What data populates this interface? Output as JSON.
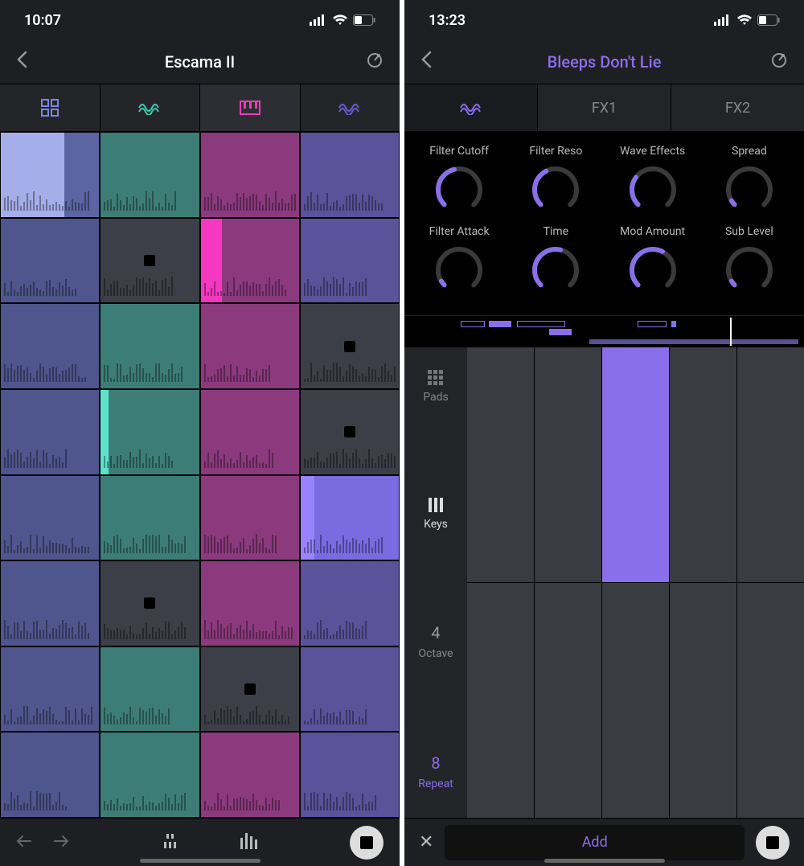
{
  "left": {
    "status_time": "10:07",
    "title": "Escama II",
    "tabs": [
      {
        "icon": "grid",
        "color": "#7a86e8"
      },
      {
        "icon": "wave",
        "color": "#3ec9b0"
      },
      {
        "icon": "keyboard",
        "color": "#e83fb5"
      },
      {
        "icon": "wave",
        "color": "#6a5acd"
      }
    ],
    "clips": [
      [
        {
          "c": "#5c64a3",
          "fill": 0.65,
          "fillc": "#aeb6f2"
        },
        {
          "c": "#3d7d77"
        },
        {
          "c": "#8b3a7e"
        },
        {
          "c": "#5b529a"
        }
      ],
      [
        {
          "c": "#4f568d"
        },
        {
          "c": "#3d3f48",
          "stop": true
        },
        {
          "c": "#8b3a7e",
          "fill": 0.22,
          "fillc": "#ff39c9"
        },
        {
          "c": "#5b529a"
        }
      ],
      [
        {
          "c": "#4f568d"
        },
        {
          "c": "#3d7d77"
        },
        {
          "c": "#8b3a7e"
        },
        {
          "c": "#3d3f48",
          "stop": true
        }
      ],
      [
        {
          "c": "#4f568d"
        },
        {
          "c": "#3d7d77",
          "fill": 0.08,
          "fillc": "#5ef0d4"
        },
        {
          "c": "#8b3a7e"
        },
        {
          "c": "#3d3f48",
          "stop": true
        }
      ],
      [
        {
          "c": "#4f568d"
        },
        {
          "c": "#3d7d77"
        },
        {
          "c": "#8b3a7e"
        },
        {
          "c": "#7c6ae0",
          "fill": 0.14,
          "fillc": "#9b86ff"
        }
      ],
      [
        {
          "c": "#4f568d"
        },
        {
          "c": "#3d3f48",
          "stop": true
        },
        {
          "c": "#8b3a7e"
        },
        {
          "c": "#5b529a"
        }
      ],
      [
        {
          "c": "#4f568d"
        },
        {
          "c": "#3d7d77"
        },
        {
          "c": "#3d3f48",
          "stop": true
        },
        {
          "c": "#5b529a"
        }
      ],
      [
        {
          "c": "#4f568d"
        },
        {
          "c": "#3d7d77"
        },
        {
          "c": "#8b3a7e"
        },
        {
          "c": "#5b529a"
        }
      ]
    ]
  },
  "right": {
    "status_time": "13:23",
    "title": "Bleeps Don't Lie",
    "tabs": [
      "wave",
      "FX1",
      "FX2"
    ],
    "knobs_row1": [
      {
        "label": "Filter Cutoff",
        "val": 0.45
      },
      {
        "label": "Filter Reso",
        "val": 0.4
      },
      {
        "label": "Wave Effects",
        "val": 0.3
      },
      {
        "label": "Spread",
        "val": 0.05
      }
    ],
    "knobs_row2": [
      {
        "label": "Filter Attack",
        "val": 0.05
      },
      {
        "label": "Time",
        "val": 0.55
      },
      {
        "label": "Mod Amount",
        "val": 0.6
      },
      {
        "label": "Sub Level",
        "val": 0.05
      }
    ],
    "side": {
      "pads": "Pads",
      "keys": "Keys",
      "octave_num": "4",
      "octave_label": "Octave",
      "repeat_num": "8",
      "repeat_label": "Repeat"
    },
    "add_label": "Add"
  }
}
